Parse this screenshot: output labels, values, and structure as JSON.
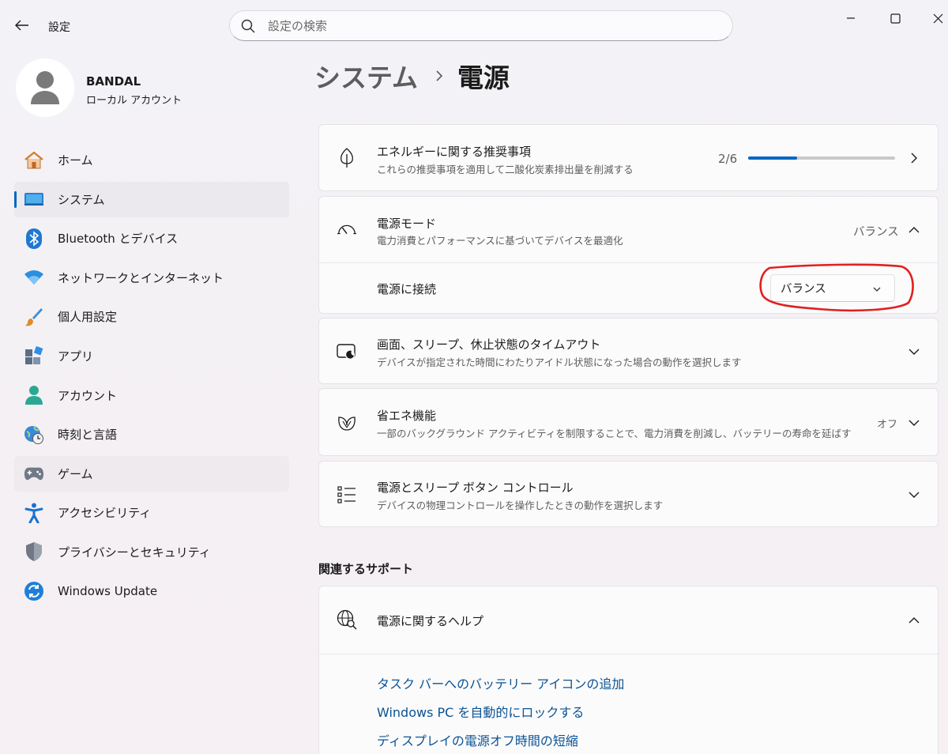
{
  "window": {
    "title": "設定",
    "back_label": "戻る"
  },
  "search": {
    "placeholder": "設定の検索"
  },
  "profile": {
    "name": "BANDAL",
    "account_type": "ローカル アカウント"
  },
  "sidebar": {
    "items": [
      {
        "label": "ホーム",
        "icon": "home-icon"
      },
      {
        "label": "システム",
        "icon": "system-icon"
      },
      {
        "label": "Bluetooth とデバイス",
        "icon": "bluetooth-icon"
      },
      {
        "label": "ネットワークとインターネット",
        "icon": "wifi-icon"
      },
      {
        "label": "個人用設定",
        "icon": "brush-icon"
      },
      {
        "label": "アプリ",
        "icon": "apps-icon"
      },
      {
        "label": "アカウント",
        "icon": "account-icon"
      },
      {
        "label": "時刻と言語",
        "icon": "clock-globe-icon"
      },
      {
        "label": "ゲーム",
        "icon": "gamepad-icon"
      },
      {
        "label": "アクセシビリティ",
        "icon": "accessibility-icon"
      },
      {
        "label": "プライバシーとセキュリティ",
        "icon": "shield-icon"
      },
      {
        "label": "Windows Update",
        "icon": "update-icon"
      }
    ]
  },
  "breadcrumb": {
    "parent": "システム",
    "current": "電源"
  },
  "energy": {
    "title": "エネルギーに関する推奨事項",
    "subtitle": "これらの推奨事項を適用して二酸化炭素排出量を削減する",
    "progress_text": "2/6",
    "progress_done": 2,
    "progress_total": 6
  },
  "power_mode": {
    "title": "電源モード",
    "subtitle": "電力消費とパフォーマンスに基づいてデバイスを最適化",
    "value": "バランス",
    "plugged_label": "電源に接続",
    "plugged_value": "バランス",
    "highlight_color": "#e0201e"
  },
  "screen_sleep": {
    "title": "画面、スリープ、休止状態のタイムアウト",
    "subtitle": "デバイスが指定された時間にわたりアイドル状態になった場合の動作を選択します"
  },
  "energy_saver": {
    "title": "省エネ機能",
    "subtitle": "一部のバックグラウンド アクティビティを制限することで、電力消費を削減し、バッテリーの寿命を延ばす",
    "value": "オフ"
  },
  "power_buttons": {
    "title": "電源とスリープ ボタン コントロール",
    "subtitle": "デバイスの物理コントロールを操作したときの動作を選択します"
  },
  "support": {
    "heading": "関連するサポート",
    "help_title": "電源に関するヘルプ",
    "links": [
      "タスク バーへのバッテリー アイコンの追加",
      "Windows PC を自動的にロックする",
      "ディスプレイの電源オフ時間の短縮"
    ]
  },
  "colors": {
    "accent": "#0067c0",
    "link": "#0b5394"
  }
}
